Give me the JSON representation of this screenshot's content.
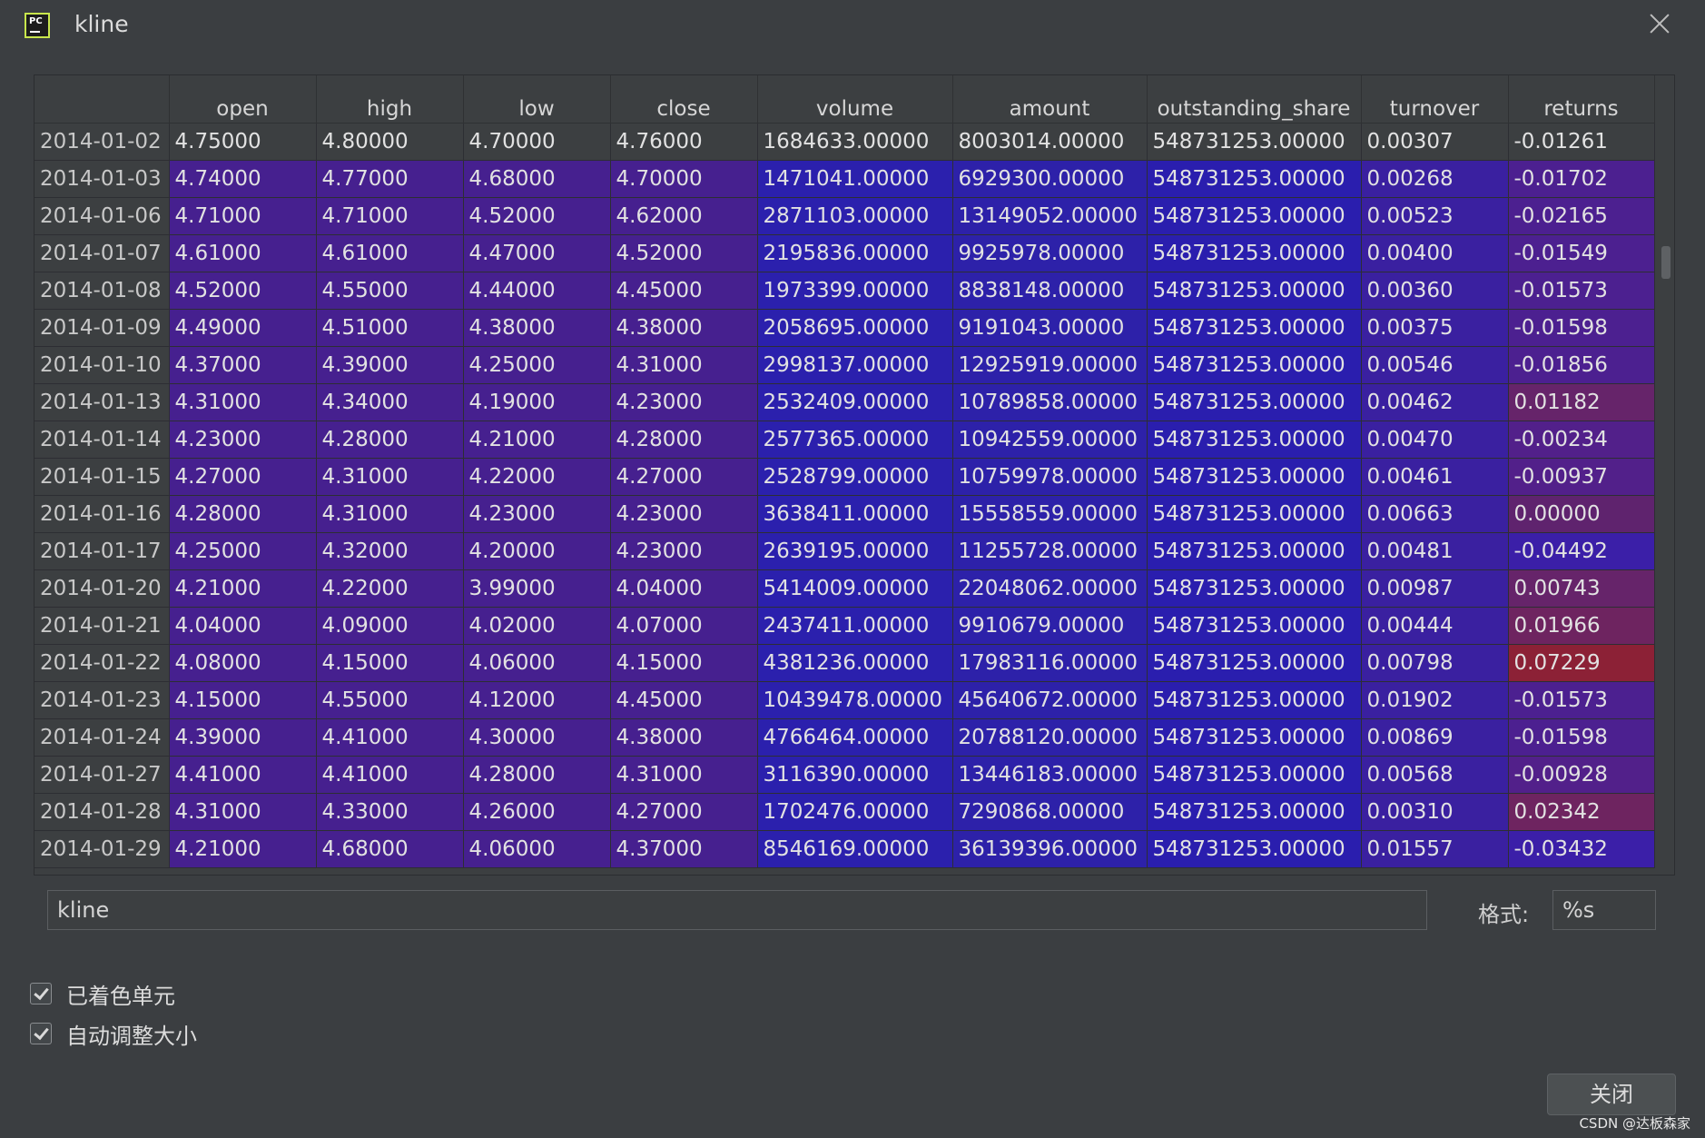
{
  "window": {
    "title": "kline",
    "app_icon_text": "PC"
  },
  "table": {
    "columns": [
      "open",
      "high",
      "low",
      "close",
      "volume",
      "amount",
      "outstanding_share",
      "turnover",
      "returns"
    ],
    "rows": [
      [
        "2014-01-02",
        "4.75000",
        "4.80000",
        "4.70000",
        "4.76000",
        "1684633.00000",
        "8003014.00000",
        "548731253.00000",
        "0.00307",
        "-0.01261"
      ],
      [
        "2014-01-03",
        "4.74000",
        "4.77000",
        "4.68000",
        "4.70000",
        "1471041.00000",
        "6929300.00000",
        "548731253.00000",
        "0.00268",
        "-0.01702"
      ],
      [
        "2014-01-06",
        "4.71000",
        "4.71000",
        "4.52000",
        "4.62000",
        "2871103.00000",
        "13149052.00000",
        "548731253.00000",
        "0.00523",
        "-0.02165"
      ],
      [
        "2014-01-07",
        "4.61000",
        "4.61000",
        "4.47000",
        "4.52000",
        "2195836.00000",
        "9925978.00000",
        "548731253.00000",
        "0.00400",
        "-0.01549"
      ],
      [
        "2014-01-08",
        "4.52000",
        "4.55000",
        "4.44000",
        "4.45000",
        "1973399.00000",
        "8838148.00000",
        "548731253.00000",
        "0.00360",
        "-0.01573"
      ],
      [
        "2014-01-09",
        "4.49000",
        "4.51000",
        "4.38000",
        "4.38000",
        "2058695.00000",
        "9191043.00000",
        "548731253.00000",
        "0.00375",
        "-0.01598"
      ],
      [
        "2014-01-10",
        "4.37000",
        "4.39000",
        "4.25000",
        "4.31000",
        "2998137.00000",
        "12925919.00000",
        "548731253.00000",
        "0.00546",
        "-0.01856"
      ],
      [
        "2014-01-13",
        "4.31000",
        "4.34000",
        "4.19000",
        "4.23000",
        "2532409.00000",
        "10789858.00000",
        "548731253.00000",
        "0.00462",
        "0.01182"
      ],
      [
        "2014-01-14",
        "4.23000",
        "4.28000",
        "4.21000",
        "4.28000",
        "2577365.00000",
        "10942559.00000",
        "548731253.00000",
        "0.00470",
        "-0.00234"
      ],
      [
        "2014-01-15",
        "4.27000",
        "4.31000",
        "4.22000",
        "4.27000",
        "2528799.00000",
        "10759978.00000",
        "548731253.00000",
        "0.00461",
        "-0.00937"
      ],
      [
        "2014-01-16",
        "4.28000",
        "4.31000",
        "4.23000",
        "4.23000",
        "3638411.00000",
        "15558559.00000",
        "548731253.00000",
        "0.00663",
        "0.00000"
      ],
      [
        "2014-01-17",
        "4.25000",
        "4.32000",
        "4.20000",
        "4.23000",
        "2639195.00000",
        "11255728.00000",
        "548731253.00000",
        "0.00481",
        "-0.04492"
      ],
      [
        "2014-01-20",
        "4.21000",
        "4.22000",
        "3.99000",
        "4.04000",
        "5414009.00000",
        "22048062.00000",
        "548731253.00000",
        "0.00987",
        "0.00743"
      ],
      [
        "2014-01-21",
        "4.04000",
        "4.09000",
        "4.02000",
        "4.07000",
        "2437411.00000",
        "9910679.00000",
        "548731253.00000",
        "0.00444",
        "0.01966"
      ],
      [
        "2014-01-22",
        "4.08000",
        "4.15000",
        "4.06000",
        "4.15000",
        "4381236.00000",
        "17983116.00000",
        "548731253.00000",
        "0.00798",
        "0.07229"
      ],
      [
        "2014-01-23",
        "4.15000",
        "4.55000",
        "4.12000",
        "4.45000",
        "10439478.00000",
        "45640672.00000",
        "548731253.00000",
        "0.01902",
        "-0.01573"
      ],
      [
        "2014-01-24",
        "4.39000",
        "4.41000",
        "4.30000",
        "4.38000",
        "4766464.00000",
        "20788120.00000",
        "548731253.00000",
        "0.00869",
        "-0.01598"
      ],
      [
        "2014-01-27",
        "4.41000",
        "4.41000",
        "4.28000",
        "4.31000",
        "3116390.00000",
        "13446183.00000",
        "548731253.00000",
        "0.00568",
        "-0.00928"
      ],
      [
        "2014-01-28",
        "4.31000",
        "4.33000",
        "4.26000",
        "4.27000",
        "1702476.00000",
        "7290868.00000",
        "548731253.00000",
        "0.00310",
        "0.02342"
      ],
      [
        "2014-01-29",
        "4.21000",
        "4.68000",
        "4.06000",
        "4.37000",
        "8546169.00000",
        "36139396.00000",
        "548731253.00000",
        "0.01557",
        "-0.03432"
      ]
    ]
  },
  "name_field": {
    "value": "kline"
  },
  "format": {
    "label": "格式:",
    "value": "%s"
  },
  "options": {
    "colored_cells": {
      "label": "已着色单元",
      "checked": true
    },
    "auto_resize": {
      "label": "自动调整大小",
      "checked": true
    }
  },
  "buttons": {
    "close_label": "关闭"
  },
  "watermark": "CSDN @达板森家",
  "colors": {
    "background": "#3b3e41",
    "cool_cell": "#46208f",
    "blue_cell": "#2b20ad",
    "hot_cell": "#8f2134"
  }
}
